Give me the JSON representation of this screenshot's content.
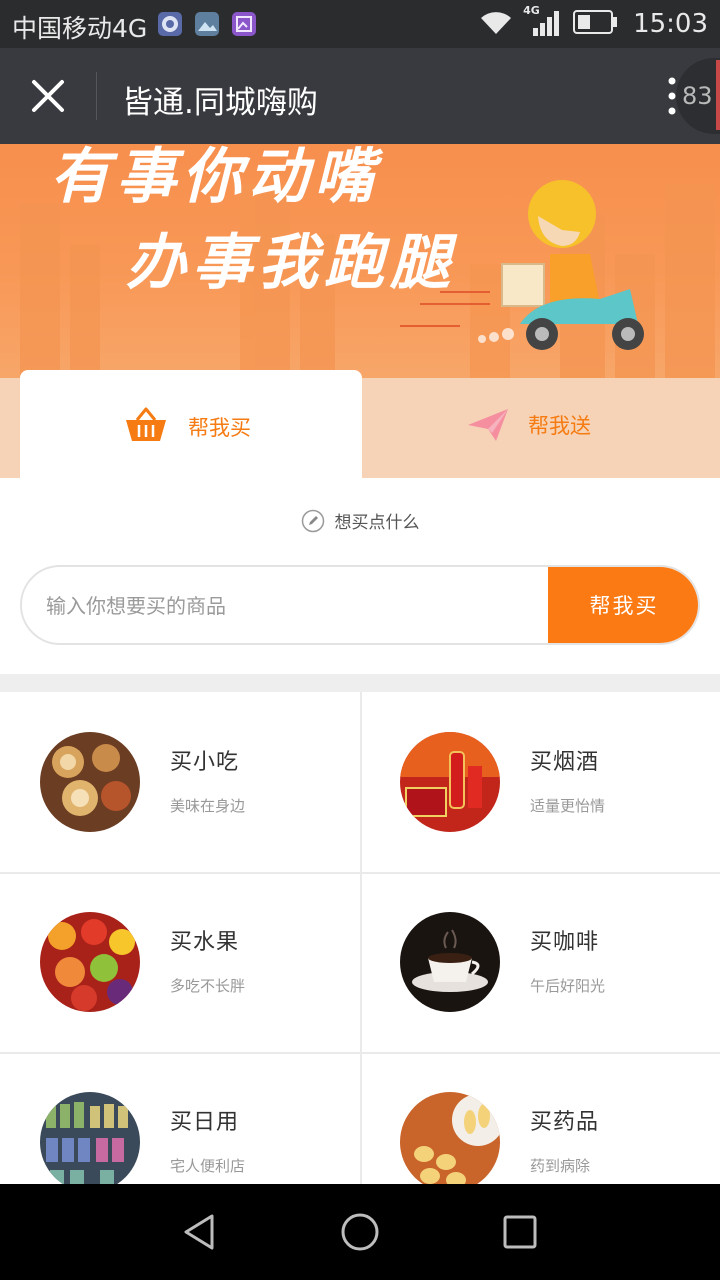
{
  "status_bar": {
    "carrier": "中国移动4G",
    "network_tag": "4G",
    "time": "15:03",
    "app_icons": [
      "message-icon",
      "gallery-icon",
      "photo-icon"
    ]
  },
  "title_bar": {
    "title": "皆通.同城嗨购",
    "badge": "83"
  },
  "banner": {
    "line1": "有事你动嘴",
    "line2": "办事我跑腿"
  },
  "tabs": [
    {
      "label": "帮我买",
      "icon": "basket-icon",
      "active": true
    },
    {
      "label": "帮我送",
      "icon": "paper-plane-icon",
      "active": false
    }
  ],
  "search": {
    "hint": "想买点什么",
    "placeholder": "输入你想要买的商品",
    "value": "",
    "button_label": "帮我买"
  },
  "categories": [
    {
      "name": "买小吃",
      "desc": "美味在身边",
      "icon": "dim-sum-photo"
    },
    {
      "name": "买烟酒",
      "desc": "适量更怡情",
      "icon": "liquor-photo"
    },
    {
      "name": "买水果",
      "desc": "多吃不长胖",
      "icon": "fruit-photo"
    },
    {
      "name": "买咖啡",
      "desc": "午后好阳光",
      "icon": "coffee-photo"
    },
    {
      "name": "买日用",
      "desc": "宅人便利店",
      "icon": "shelf-photo"
    },
    {
      "name": "买药品",
      "desc": "药到病除",
      "icon": "pills-photo"
    }
  ],
  "colors": {
    "accent": "#fc7a13",
    "tab_inactive_bg": "#f6d3b6",
    "banner": "#f89857",
    "title_bar": "#393a3f",
    "status_bar": "#2b2c2e"
  }
}
